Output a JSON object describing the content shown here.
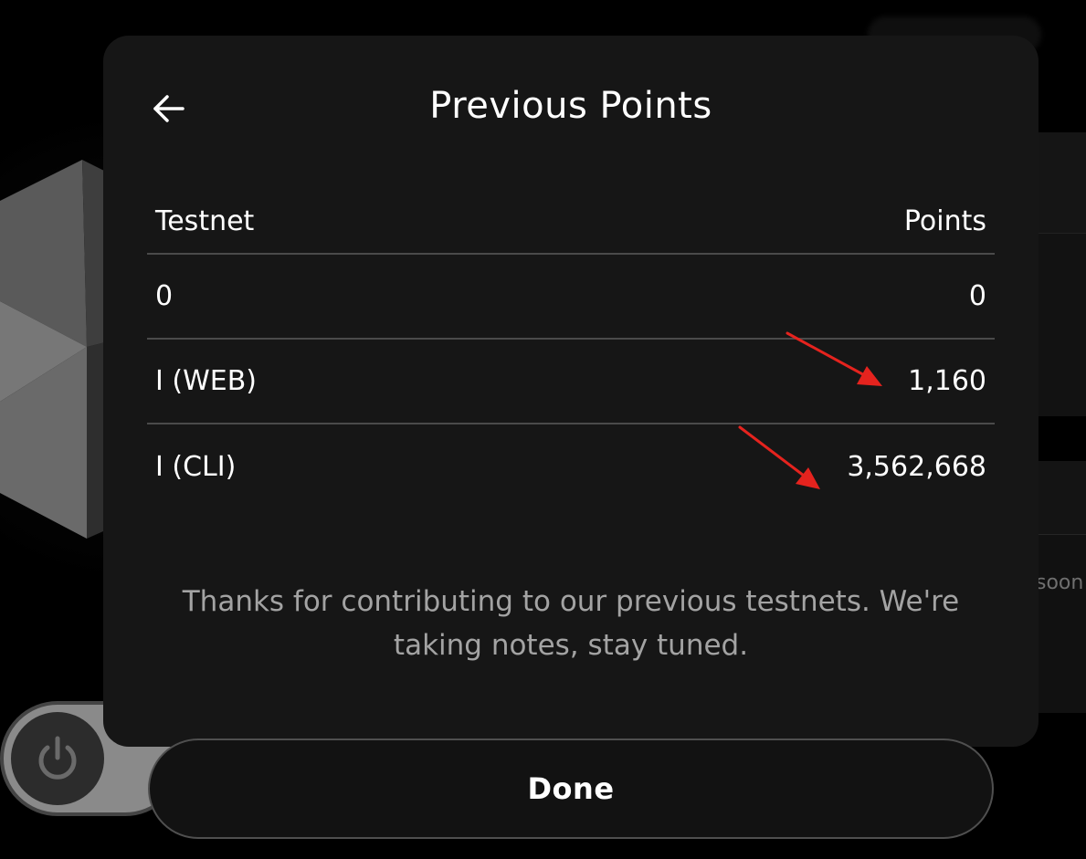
{
  "modal": {
    "title": "Previous Points",
    "back_icon": "arrow-left-icon",
    "table": {
      "headers": {
        "testnet": "Testnet",
        "points": "Points"
      },
      "rows": [
        {
          "testnet": "0",
          "points": "0"
        },
        {
          "testnet": "I (WEB)",
          "points": "1,160"
        },
        {
          "testnet": "I (CLI)",
          "points": "3,562,668"
        }
      ]
    },
    "thanks_message": "Thanks for contributing to our previous testnets. We're taking notes, stay tuned.",
    "done_label": "Done"
  },
  "background": {
    "partial_text": "soon",
    "toggle_icon": "power-icon"
  },
  "annotations": {
    "arrow_color": "#e5231e",
    "arrow_icon": "red-arrow-icon"
  },
  "colors": {
    "modal_bg": "#161616",
    "text_primary": "#ffffff",
    "text_secondary": "#a3a3a3",
    "divider": "#4a4a4a"
  }
}
